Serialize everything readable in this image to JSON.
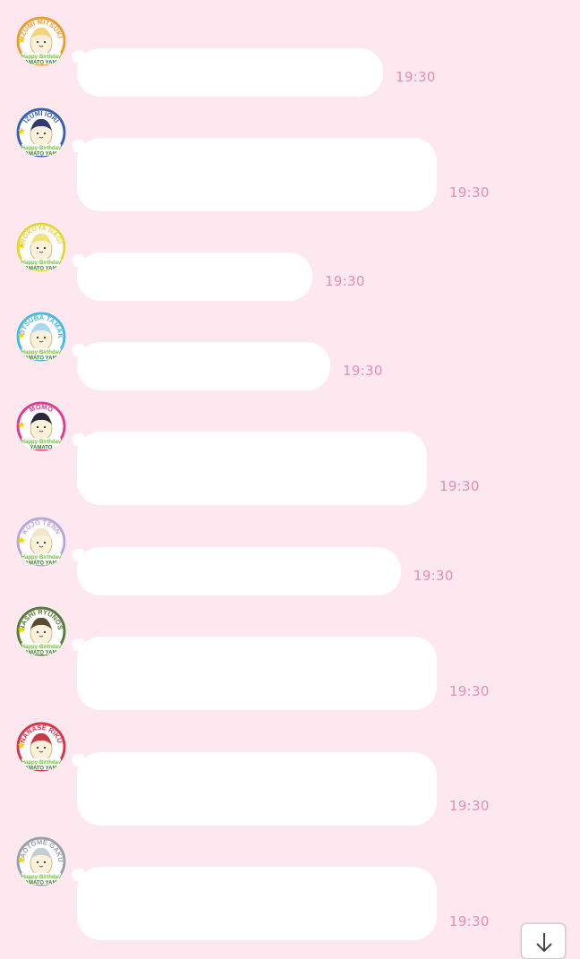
{
  "colors": {
    "background": "#fde8f0",
    "bubble": "#ffffff",
    "timestamp": "#e58fb0"
  },
  "messages": [
    {
      "avatar_label": "IZUMI MITSUKI",
      "avatar_ring": "#f29a2e",
      "avatar_hair": "#f6d27a",
      "sticker_text": "Happy Birthday YAMATO YAMA",
      "text": "",
      "time": "19:30"
    },
    {
      "avatar_label": "IZUMI IORI",
      "avatar_ring": "#3b5fb5",
      "avatar_hair": "#2f3b6e",
      "sticker_text": "Happy Birthday YAMATO YAMA",
      "text": "",
      "time": "19:30"
    },
    {
      "avatar_label": "ROKUYA NAGI",
      "avatar_ring": "#e8d33c",
      "avatar_hair": "#f4e27a",
      "sticker_text": "Happy Birthday YAMATO YAMA",
      "text": "",
      "time": "19:30"
    },
    {
      "avatar_label": "YOTSUBA TAMAKI",
      "avatar_ring": "#4bb8e0",
      "avatar_hair": "#a9d8f0",
      "sticker_text": "Happy Birthday YAMATO YAMA",
      "text": "",
      "time": "19:30"
    },
    {
      "avatar_label": "MOMO",
      "avatar_ring": "#e23a8c",
      "avatar_hair": "#2a2a3a",
      "sticker_text": "YAMATO",
      "text": "",
      "time": "19:30"
    },
    {
      "avatar_label": "KUJO TENN",
      "avatar_ring": "#b9a6d6",
      "avatar_hair": "#f2e6c8",
      "sticker_text": "Happy Birthday YAMATO YAMA",
      "text": "",
      "time": "19:30"
    },
    {
      "avatar_label": "TSUNASHI RYUNOSUKE",
      "avatar_ring": "#5a7a3a",
      "avatar_hair": "#5a4a30",
      "sticker_text": "Happy Birthday YAMATO YAMA",
      "text": "",
      "time": "19:30"
    },
    {
      "avatar_label": "NANASE RIKU",
      "avatar_ring": "#d8344a",
      "avatar_hair": "#c93a44",
      "sticker_text": "Happy Birthday YAMATO YAMA",
      "text": "",
      "time": "19:30"
    },
    {
      "avatar_label": "YAOTOME GAKU",
      "avatar_ring": "#9aa0a6",
      "avatar_hair": "#c8cdd2",
      "sticker_text": "Happy Birthday YAMATO YAMA",
      "text": "",
      "time": "19:30"
    }
  ],
  "scroll_button": {
    "icon": "arrow-down-icon"
  }
}
